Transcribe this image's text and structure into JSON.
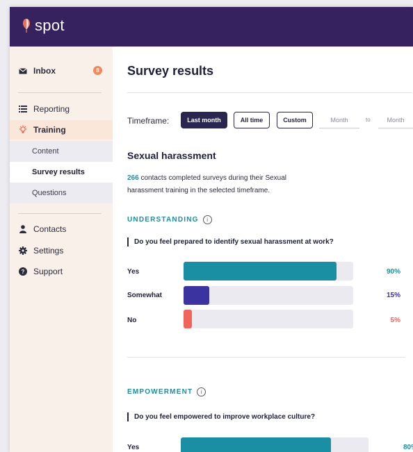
{
  "app": {
    "brand": "spot",
    "brand_color": "#35225f"
  },
  "sidebar": {
    "inbox": {
      "label": "Inbox",
      "badge": "8",
      "icon": "envelope-icon"
    },
    "items": [
      {
        "label": "Reporting",
        "icon": "list-icon"
      },
      {
        "label": "Training",
        "icon": "lightbulb-icon"
      }
    ],
    "sub_items": [
      {
        "label": "Content"
      },
      {
        "label": "Survey results"
      },
      {
        "label": "Questions"
      }
    ],
    "bottom_items": [
      {
        "label": "Contacts",
        "icon": "person-icon"
      },
      {
        "label": "Settings",
        "icon": "gear-icon"
      },
      {
        "label": "Support",
        "icon": "help-icon"
      }
    ]
  },
  "main": {
    "title": "Survey results",
    "timeframe": {
      "label": "Timeframe:",
      "buttons": [
        "Last month",
        "All time",
        "Custom"
      ],
      "selected": "Last month",
      "from_placeholder": "Month",
      "to_label": "to",
      "to_placeholder": "Month"
    },
    "section_title": "Sexual harassment",
    "description_count": "266",
    "description_text": " contacts completed surveys during their Sexual harassment training in the selected timeframe.",
    "questions": [
      {
        "category": "UNDERSTANDING",
        "text": "Do you feel prepared to identify sexual harassment at work?",
        "answers": [
          {
            "label": "Yes",
            "pct_text": "90%",
            "value": 90,
            "color": "#1a8ea3"
          },
          {
            "label": "Somewhat",
            "pct_text": "15%",
            "value": 15,
            "color": "#3a33a0"
          },
          {
            "label": "No",
            "pct_text": "5%",
            "value": 5,
            "color": "#f0645a"
          }
        ]
      },
      {
        "category": "EMPOWERMENT",
        "text": "Do you feel empowered to improve workplace culture?",
        "answers": [
          {
            "label": "Yes",
            "pct_text": "80%",
            "value": 80,
            "color": "#1a8ea3"
          }
        ]
      }
    ]
  }
}
